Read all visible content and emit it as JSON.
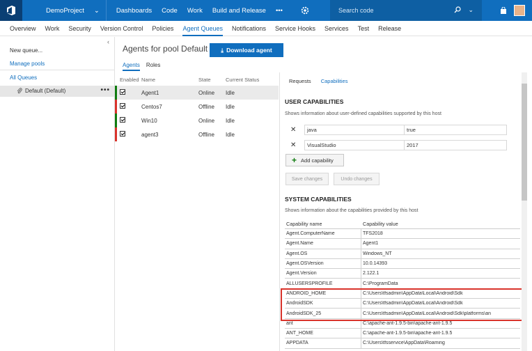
{
  "topbar": {
    "project": "DemoProject",
    "nav": [
      "Dashboards",
      "Code",
      "Work",
      "Build and Release"
    ],
    "more": "•••",
    "search_placeholder": "Search code"
  },
  "subnav": {
    "items": [
      "Overview",
      "Work",
      "Security",
      "Version Control",
      "Policies",
      "Agent Queues",
      "Notifications",
      "Service Hooks",
      "Services",
      "Test",
      "Release"
    ],
    "active": "Agent Queues"
  },
  "left": {
    "new_queue": "New queue...",
    "manage_pools": "Manage pools",
    "all_queues": "All Queues",
    "selected_queue": "Default (Default)",
    "more": "•••"
  },
  "main": {
    "title": "Agents for pool Default",
    "download_button": "Download agent",
    "tabs": [
      "Agents",
      "Roles"
    ]
  },
  "agents": {
    "headers": [
      "Enabled",
      "Name",
      "State",
      "Current Status"
    ],
    "rows": [
      {
        "name": "Agent1",
        "state": "Online",
        "status": "Idle",
        "color": "#107c10",
        "enabled": true
      },
      {
        "name": "Centos7",
        "state": "Offline",
        "status": "Idle",
        "color": "#d9332b",
        "enabled": true
      },
      {
        "name": "Win10",
        "state": "Online",
        "status": "Idle",
        "color": "#107c10",
        "enabled": true
      },
      {
        "name": "agent3",
        "state": "Offline",
        "status": "Idle",
        "color": "#d9332b",
        "enabled": true
      }
    ]
  },
  "right": {
    "tabs": [
      "Requests",
      "Capabilities"
    ],
    "user_title": "USER CAPABILITIES",
    "user_desc": "Shows information about user-defined capabilities supported by this host",
    "user_caps": [
      {
        "key": "java",
        "value": "true"
      },
      {
        "key": "VisualStudio",
        "value": "2017"
      }
    ],
    "add_capability": "Add capability",
    "save_changes": "Save changes",
    "undo_changes": "Undo changes",
    "system_title": "SYSTEM CAPABILITIES",
    "system_desc": "Shows information about the capabilities provided by this host",
    "system_headers": [
      "Capability name",
      "Capability value"
    ],
    "system_caps": [
      {
        "key": "Agent.ComputerName",
        "value": "TFS2018"
      },
      {
        "key": "Agent.Name",
        "value": "Agent1"
      },
      {
        "key": "Agent.OS",
        "value": "Windows_NT"
      },
      {
        "key": "Agent.OSVersion",
        "value": "10.0.14393"
      },
      {
        "key": "Agent.Version",
        "value": "2.122.1"
      },
      {
        "key": "ALLUSERSPROFILE",
        "value": "C:\\ProgramData"
      },
      {
        "key": "ANDROID_HOME",
        "value": "C:\\Users\\tfsadmin\\AppData\\Local\\Android\\Sdk"
      },
      {
        "key": "AndroidSDK",
        "value": "C:\\Users\\tfsadmin\\AppData\\Local\\Android\\Sdk"
      },
      {
        "key": "AndroidSDK_25",
        "value": "C:\\Users\\tfsadmin\\AppData\\Local\\Android\\Sdk\\platforms\\an"
      },
      {
        "key": "ant",
        "value": "C:\\apache-ant-1.9.5-bin\\apache-ant-1.9.5"
      },
      {
        "key": "ANT_HOME",
        "value": "C:\\apache-ant-1.9.5-bin\\apache-ant-1.9.5"
      },
      {
        "key": "APPDATA",
        "value": "C:\\Users\\tfsservice\\AppData\\Roaming"
      }
    ]
  },
  "colors": {
    "accent": "#106ebe",
    "online": "#107c10",
    "offline": "#d9332b",
    "highlight": "#d9332b"
  }
}
